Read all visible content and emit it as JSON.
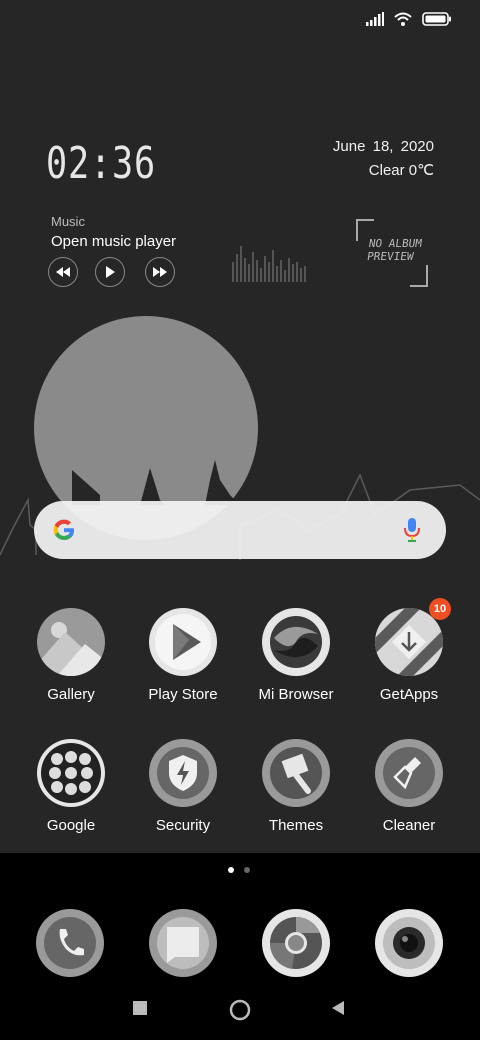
{
  "clock": {
    "time": "02:36"
  },
  "date": {
    "text": "June  18, 2020",
    "weather": "Clear  0℃"
  },
  "music": {
    "label": "Music",
    "title": "Open music player"
  },
  "album": {
    "line1": "NO ALBUM",
    "line2": "PREVIEW"
  },
  "apps_row1": [
    {
      "label": "Gallery",
      "icon": "gallery-icon"
    },
    {
      "label": "Play Store",
      "icon": "play-store-icon"
    },
    {
      "label": "Mi Browser",
      "icon": "mi-browser-icon"
    },
    {
      "label": "GetApps",
      "icon": "getapps-icon",
      "badge": "10"
    }
  ],
  "apps_row2": [
    {
      "label": "Google",
      "icon": "google-folder-icon"
    },
    {
      "label": "Security",
      "icon": "security-icon"
    },
    {
      "label": "Themes",
      "icon": "themes-icon"
    },
    {
      "label": "Cleaner",
      "icon": "cleaner-icon"
    }
  ],
  "dock": [
    {
      "icon": "phone-icon"
    },
    {
      "icon": "messages-icon"
    },
    {
      "icon": "chrome-icon"
    },
    {
      "icon": "camera-icon"
    }
  ],
  "colors": {
    "badge": "#f04e23",
    "background": "#262626",
    "dock": "#000000"
  }
}
